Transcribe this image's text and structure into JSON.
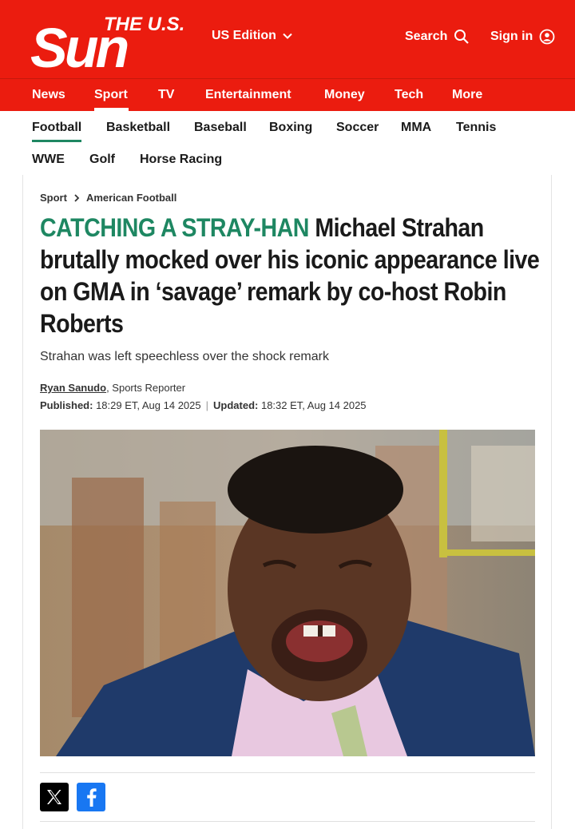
{
  "brand": {
    "logo_line1": "THE U.S.",
    "logo_line2": "Sun",
    "primary_color": "#eb1c0f",
    "accent_color": "#1e8762"
  },
  "header": {
    "edition_label": "US Edition",
    "search_label": "Search",
    "signin_label": "Sign in"
  },
  "main_nav": {
    "items": [
      "News",
      "Sport",
      "TV",
      "Entertainment",
      "Money",
      "Tech",
      "More"
    ],
    "active": "Sport"
  },
  "sub_nav": {
    "items": [
      "Football",
      "Basketball",
      "Baseball",
      "Boxing",
      "Soccer",
      "MMA",
      "Tennis",
      "WWE",
      "Golf",
      "Horse Racing"
    ],
    "active": "Football"
  },
  "article": {
    "breadcrumb": [
      "Sport",
      "American Football"
    ],
    "kicker": "CATCHING A STRAY-HAN",
    "headline": "Michael Strahan brutally mocked over his iconic appearance live on GMA in ‘savage’ remark by co-host Robin Roberts",
    "standfirst": "Strahan was left speechless over the shock remark",
    "author": "Ryan Sanudo",
    "author_role": ", Sports Reporter",
    "published_label": "Published:",
    "published_value": " 18:29 ET, Aug 14 2025",
    "updated_label": "Updated:",
    "updated_value": " 18:32 ET, Aug 14 2025",
    "separator": "|"
  },
  "share": {
    "icons": [
      "x-icon",
      "facebook-icon"
    ]
  }
}
